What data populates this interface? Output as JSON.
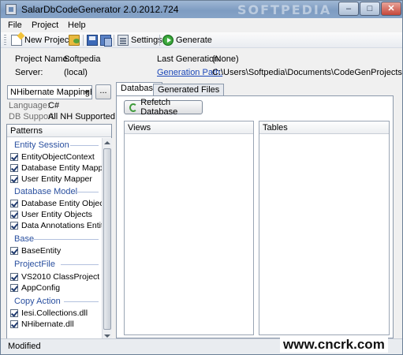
{
  "window": {
    "title": "SalarDbCodeGenerator 2.0.2012.724",
    "watermark": "SOFTPEDIA"
  },
  "menu": [
    "File",
    "Project",
    "Help"
  ],
  "toolbar": {
    "new_project": "New Project",
    "settings": "Settings",
    "generate": "Generate"
  },
  "info": {
    "project_name_label": "Project Name:",
    "project_name_value": "Softpedia",
    "server_label": "Server:",
    "server_value": "(local)",
    "last_generation_label": "Last Generation:",
    "last_generation_value": "(None)",
    "generation_path_label": "Generation Path:",
    "generation_path_value": "C:\\Users\\Softpedia\\Documents\\CodeGenProjects"
  },
  "left": {
    "pattern_combo_value": "NHibernate MappingByC",
    "dots_label": "...",
    "language_label": "Language:",
    "language_value": "C#",
    "db_support_label": "DB Support:",
    "db_support_value": "All NH Supported ..."
  },
  "patterns": {
    "header": "Patterns",
    "groups": [
      {
        "title": "Entity Session",
        "items": [
          "EntityObjectContext",
          "Database Entity Mapper",
          "User Entity Mapper"
        ]
      },
      {
        "title": "Database Model",
        "items": [
          "Database Entity Objects",
          "User Entity Objects",
          "Data Annotations Entity Obj..."
        ]
      },
      {
        "title": "Base",
        "items": [
          "BaseEntity"
        ]
      },
      {
        "title": "ProjectFile",
        "items": [
          "VS2010 ClassProject",
          "AppConfig"
        ]
      },
      {
        "title": "Copy Action",
        "items": [
          "Iesi.Collections.dll",
          "NHibernate.dll"
        ]
      }
    ]
  },
  "tabs": [
    "Database",
    "Generated Files"
  ],
  "database_tab": {
    "refetch_button": "Refetch Database",
    "views_header": "Views",
    "tables_header": "Tables"
  },
  "status": {
    "text": "Modified"
  },
  "site_watermark": "www.cncrk.com"
}
